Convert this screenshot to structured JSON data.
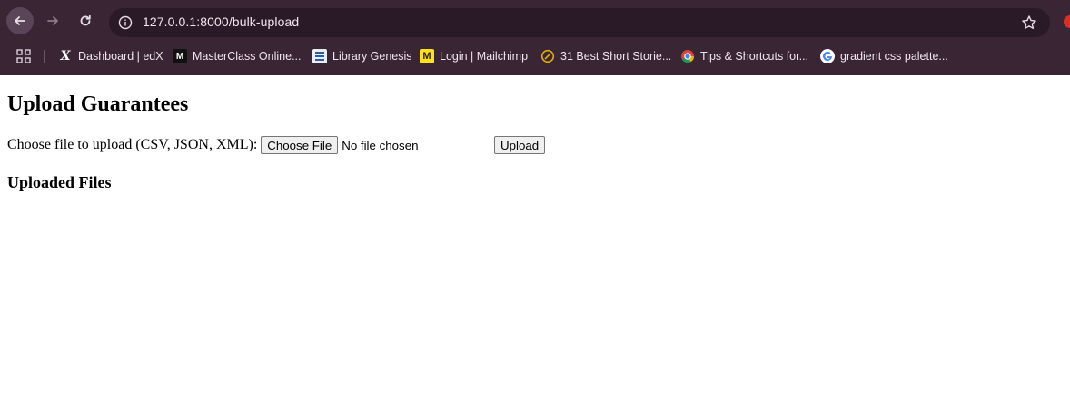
{
  "browser": {
    "url": "127.0.0.1:8000/bulk-upload",
    "bookmarks": [
      {
        "label": "Dashboard | edX",
        "icon": "edx-icon"
      },
      {
        "label": "MasterClass Online...",
        "icon": "masterclass-icon"
      },
      {
        "label": "Library Genesis",
        "icon": "library-genesis-icon"
      },
      {
        "label": "Login | Mailchimp",
        "icon": "mailchimp-icon"
      },
      {
        "label": "31 Best Short Storie...",
        "icon": "short-stories-icon"
      },
      {
        "label": "Tips & Shortcuts for...",
        "icon": "chrome-icon"
      },
      {
        "label": "gradient css palette...",
        "icon": "google-icon"
      }
    ]
  },
  "page": {
    "title": "Upload Guarantees",
    "form_label": "Choose file to upload (CSV, JSON, XML):",
    "choose_file_label": "Choose File",
    "no_file_text": "No file chosen",
    "upload_label": "Upload",
    "uploaded_heading": "Uploaded Files"
  },
  "colors": {
    "chrome_bg": "#3a2535",
    "omnibox_bg": "#2a1a27",
    "page_bg": "#ffffff"
  }
}
